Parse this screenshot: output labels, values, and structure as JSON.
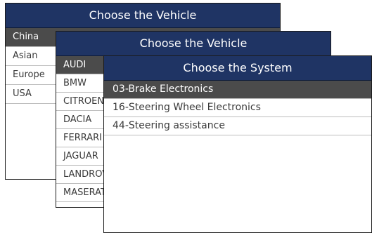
{
  "windows": {
    "vehicle_region": {
      "title": "Choose the Vehicle",
      "items": [
        "China",
        "Asian",
        "Europe",
        "USA"
      ],
      "selected_index": 0
    },
    "vehicle_make": {
      "title": "Choose the Vehicle",
      "items": [
        "AUDI",
        "BMW",
        "CITROEN",
        "DACIA",
        "FERRARI",
        "JAGUAR",
        "LANDROVER",
        "MASERATI"
      ],
      "selected_index": 0
    },
    "system": {
      "title": "Choose the System",
      "items": [
        "03-Brake Electronics",
        "16-Steering Wheel Electronics",
        "44-Steering assistance"
      ],
      "selected_index": 0
    }
  },
  "colors": {
    "title_bar": "#1f3464",
    "selected_row": "#4b4b4b",
    "row_divider": "#bdbdbd"
  }
}
